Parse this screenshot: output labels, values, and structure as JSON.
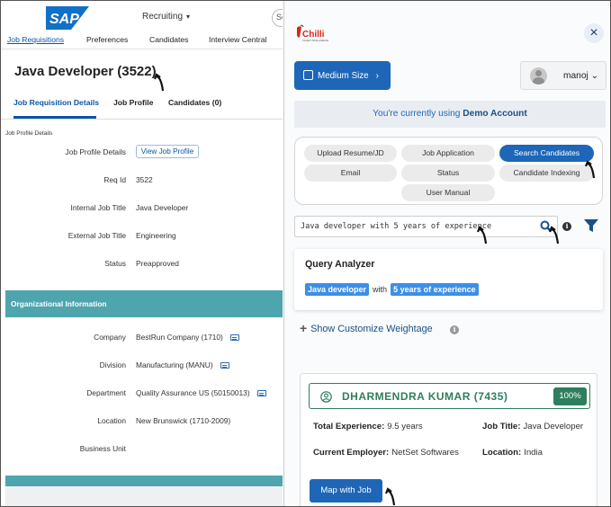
{
  "sap": {
    "brand": "SAP",
    "module": "Recruiting",
    "search_stub": "Se",
    "nav": [
      {
        "label": "Job Requisitions"
      },
      {
        "label": "Preferences"
      },
      {
        "label": "Candidates"
      },
      {
        "label": "Interview Central"
      }
    ],
    "job_title": "Java Developer (3522)",
    "tabs": [
      {
        "label": "Job Requisition Details"
      },
      {
        "label": "Job Profile"
      },
      {
        "label": "Candidates (0)"
      }
    ],
    "section_label": "Job Profile Details",
    "fields": {
      "job_profile_details": {
        "label": "Job Profile Details",
        "button": "View Job Profile"
      },
      "req_id": {
        "label": "Req Id",
        "value": "3522"
      },
      "internal_title": {
        "label": "Internal Job Title",
        "value": "Java Developer"
      },
      "external_title": {
        "label": "External Job Title",
        "value": "Engineering"
      },
      "status": {
        "label": "Status",
        "value": "Preapproved"
      }
    },
    "org_header": "Organizational Information",
    "org_fields": {
      "company": {
        "label": "Company",
        "value": "BestRun Company (1710)"
      },
      "division": {
        "label": "Division",
        "value": "Manufacturing (MANU)"
      },
      "department": {
        "label": "Department",
        "value": "Quality Assurance US (50150013)"
      },
      "location": {
        "label": "Location",
        "value": "New Brunswick (1710-2009)"
      },
      "business_unit": {
        "label": "Business Unit",
        "value": ""
      }
    },
    "colors": {
      "accent": "#0a55a8",
      "teal": "#4ea5ad"
    }
  },
  "chilli": {
    "logo_text": "Chilli",
    "logo_tagline": "TALENT INTELLIGENCE",
    "close_icon": "close-icon",
    "size_button": "Medium Size",
    "user_name": "manoj",
    "demo_prefix": "You're currently using",
    "demo_account": "Demo Account",
    "menu": [
      {
        "label": "Upload Resume/JD",
        "active": false
      },
      {
        "label": "Job Application",
        "active": false
      },
      {
        "label": "Search Candidates",
        "active": true
      },
      {
        "label": "Email",
        "active": false
      },
      {
        "label": "Status",
        "active": false
      },
      {
        "label": "Candidate Indexing",
        "active": false
      },
      {
        "label": "User Manual",
        "active": false
      }
    ],
    "search_value": "Java developer with 5 years of experience",
    "query_analyzer": {
      "title": "Query Analyzer",
      "tag1": "Java developer",
      "connector": "with",
      "tag2": "5 years of experience"
    },
    "weightage_label": "Show Customize Weightage",
    "candidate": {
      "name": "DHARMENDRA KUMAR (7435)",
      "match": "100%",
      "experience_label": "Total Experience:",
      "experience": "9.5 years",
      "job_title_label": "Job Title:",
      "job_title": "Java Developer",
      "employer_label": "Current Employer:",
      "employer": "NetSet Softwares",
      "location_label": "Location:",
      "location": "India"
    },
    "map_button": "Map with Job",
    "colors": {
      "primary": "#1e66b8",
      "green": "#2e7f5e",
      "tag": "#3d8ee8"
    }
  }
}
